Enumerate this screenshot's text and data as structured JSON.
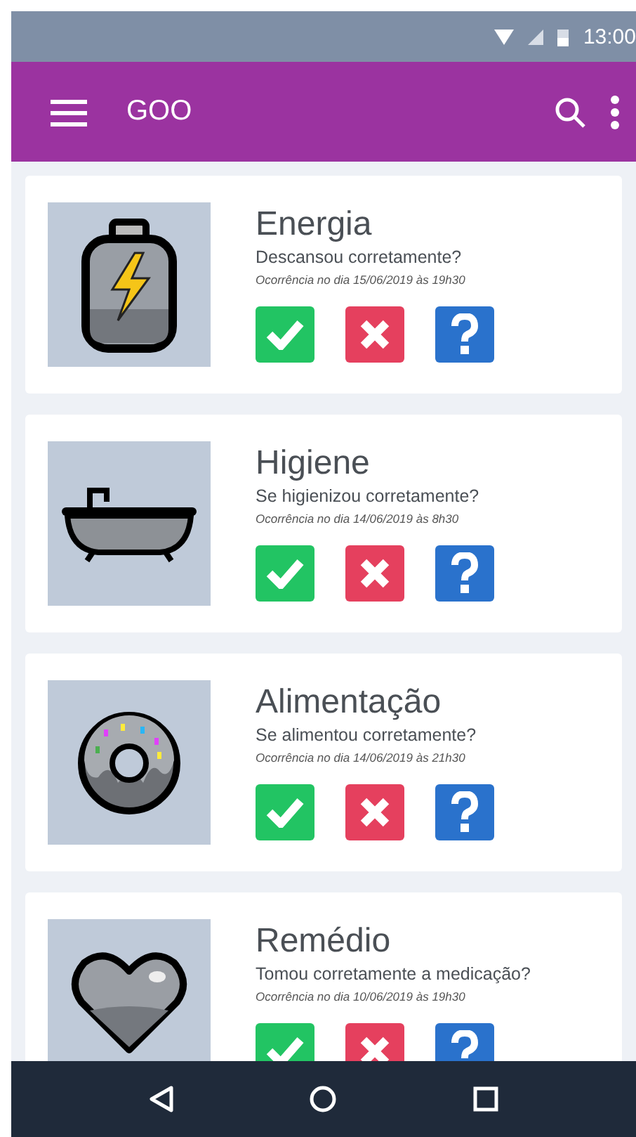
{
  "status_bar": {
    "time": "13:00"
  },
  "app_bar": {
    "title": "GOO"
  },
  "cards": [
    {
      "kind": "battery",
      "title": "Energia",
      "question": "Descansou corretamente?",
      "occurrence": "Ocorrência no dia 15/06/2019 às 19h30"
    },
    {
      "kind": "bathtub",
      "title": "Higiene",
      "question": "Se higienizou corretamente?",
      "occurrence": "Ocorrência no dia 14/06/2019 às 8h30"
    },
    {
      "kind": "donut",
      "title": "Alimentação",
      "question": "Se alimentou corretamente?",
      "occurrence": "Ocorrência no dia 14/06/2019 às 21h30"
    },
    {
      "kind": "heart",
      "title": "Remédio",
      "question": "Tomou corretamente a medicação?",
      "occurrence": "Ocorrência no dia 10/06/2019 às 19h30"
    }
  ]
}
